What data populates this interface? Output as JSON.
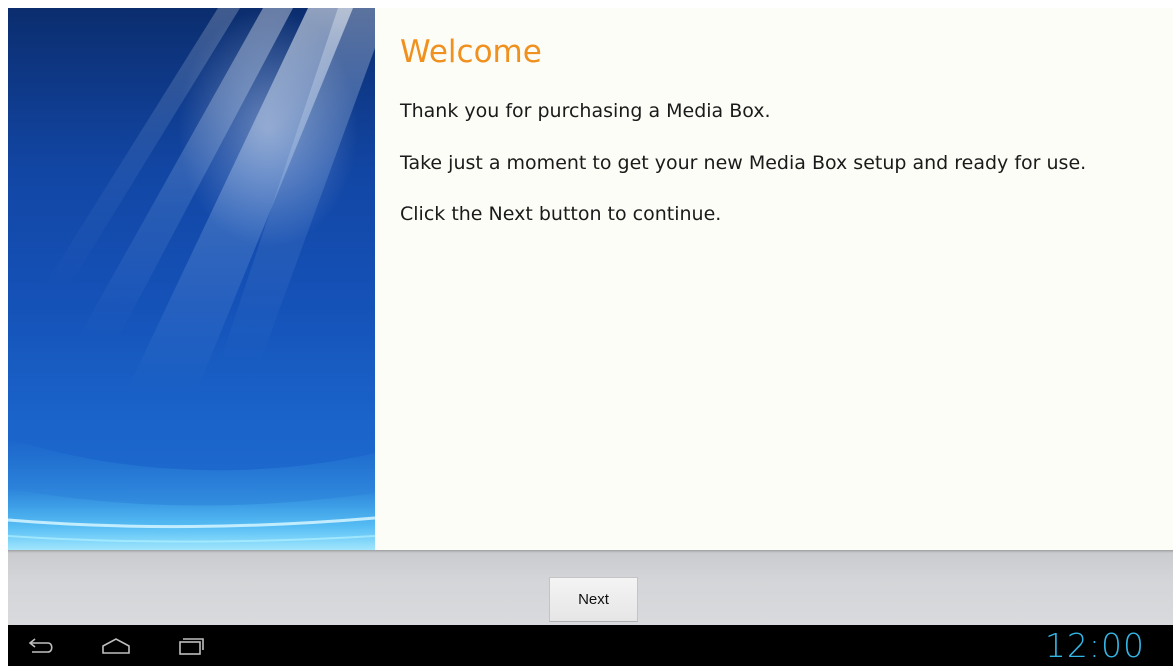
{
  "welcome": {
    "title": "Welcome",
    "paragraphs": [
      "Thank you for purchasing a Media Box.",
      "Take just a moment to get your new Media Box setup and ready for use.",
      "Click the Next button to continue."
    ]
  },
  "buttonbar": {
    "next_label": "Next"
  },
  "navbar": {
    "icons": [
      "back-icon",
      "home-icon",
      "recent-apps-icon"
    ],
    "clock": "12:00"
  },
  "colors": {
    "title": "#f0901e",
    "clock": "#33b5e5",
    "artwork_blue": "#1552b8"
  }
}
